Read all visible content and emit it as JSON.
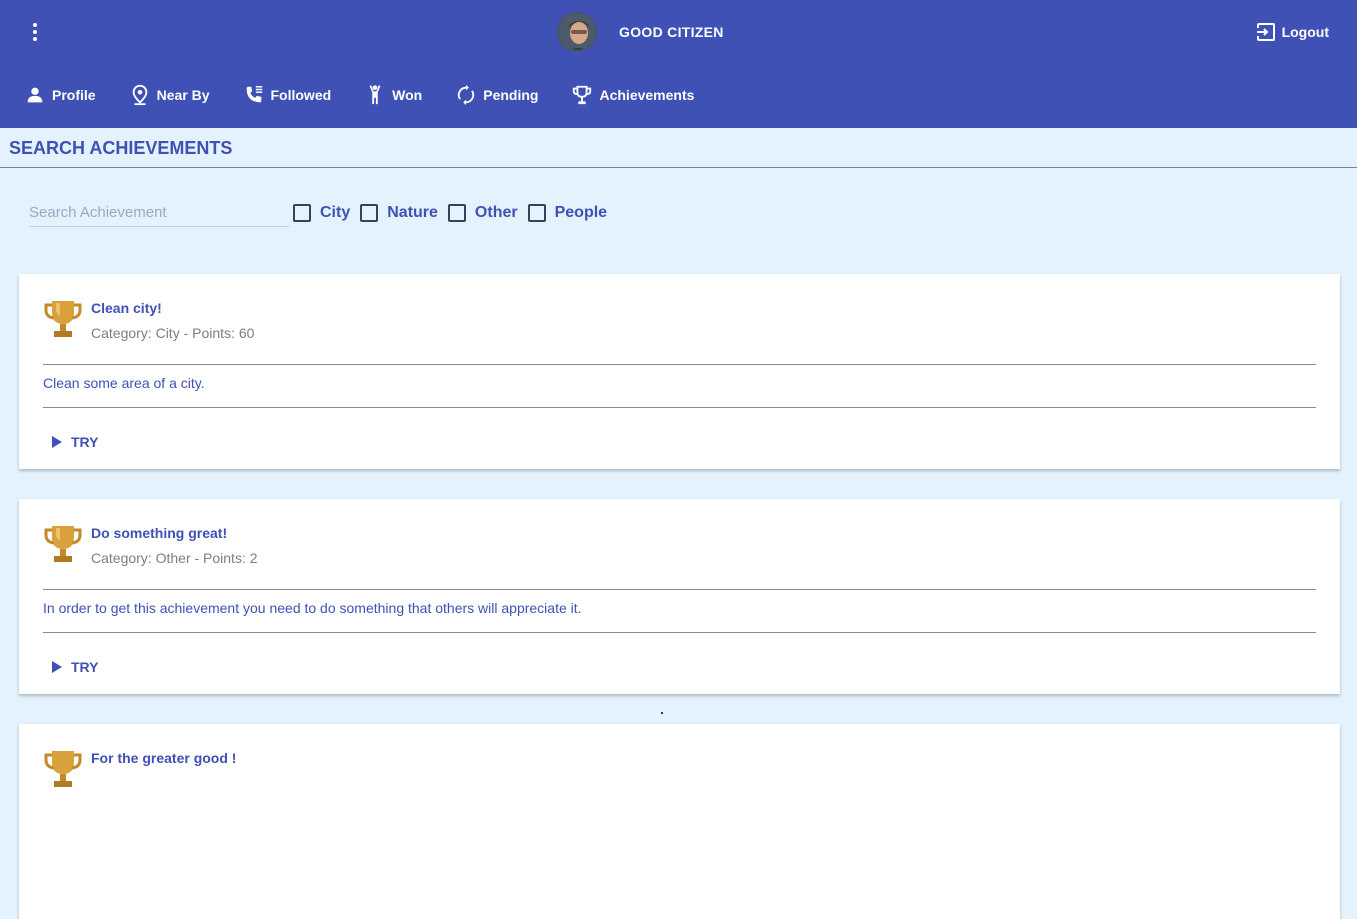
{
  "header": {
    "app_title": "GOOD CITIZEN",
    "logout_label": "Logout"
  },
  "nav": {
    "items": [
      {
        "label": "Profile",
        "icon": "person-icon"
      },
      {
        "label": "Near By",
        "icon": "location-pin-icon"
      },
      {
        "label": "Followed",
        "icon": "phone-icon"
      },
      {
        "label": "Won",
        "icon": "person-raised-arms-icon"
      },
      {
        "label": "Pending",
        "icon": "sync-icon"
      },
      {
        "label": "Achievements",
        "icon": "trophy-icon"
      }
    ]
  },
  "page": {
    "section_title": "SEARCH ACHIEVEMENTS"
  },
  "filters": {
    "search_placeholder": "Search Achievement",
    "search_value": "",
    "categories": [
      "City",
      "Nature",
      "Other",
      "People"
    ]
  },
  "achievements": [
    {
      "title": "Clean city!",
      "subtitle": "Category: City - Points: 60",
      "description": "Clean some area of a city.",
      "action": "TRY"
    },
    {
      "title": "Do something great!",
      "subtitle": "Category: Other - Points: 2",
      "description": "In order to get this achievement you need to do something that others will appreciate it.",
      "action": "TRY"
    },
    {
      "title": "For the greater good !",
      "subtitle": "",
      "description": "",
      "action": ""
    }
  ],
  "colors": {
    "primary": "#3f51b5",
    "background": "#e3f2fd",
    "card": "#ffffff",
    "trophy_gold": "#d9a13b"
  }
}
